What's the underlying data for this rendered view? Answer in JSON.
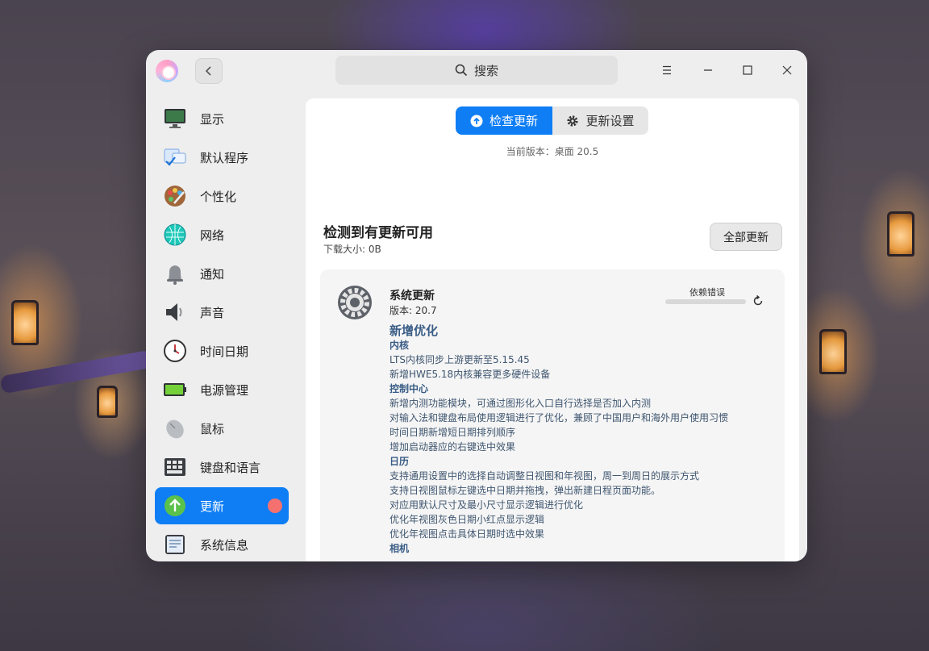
{
  "header": {
    "search_label": "搜索"
  },
  "sidebar": {
    "items": [
      {
        "label": "显示",
        "icon": "monitor-icon"
      },
      {
        "label": "默认程序",
        "icon": "default-apps-icon"
      },
      {
        "label": "个性化",
        "icon": "palette-icon"
      },
      {
        "label": "网络",
        "icon": "network-icon"
      },
      {
        "label": "通知",
        "icon": "bell-icon"
      },
      {
        "label": "声音",
        "icon": "speaker-icon"
      },
      {
        "label": "时间日期",
        "icon": "clock-icon"
      },
      {
        "label": "电源管理",
        "icon": "battery-icon"
      },
      {
        "label": "鼠标",
        "icon": "mouse-icon"
      },
      {
        "label": "键盘和语言",
        "icon": "keyboard-icon"
      },
      {
        "label": "更新",
        "icon": "update-arrow-icon",
        "active": true
      },
      {
        "label": "系统信息",
        "icon": "system-info-icon"
      }
    ]
  },
  "tabs": {
    "check": "检查更新",
    "settings": "更新设置"
  },
  "current_version": "当前版本：桌面 20.5",
  "updates": {
    "title": "检测到有更新可用",
    "download_size": "下载大小: 0B",
    "update_all": "全部更新"
  },
  "card": {
    "name": "系统更新",
    "version": "版本: 20.7",
    "status": "依赖错误",
    "notes_title": "新增优化",
    "notes": [
      {
        "text": "内核",
        "heading": true
      },
      {
        "text": "LTS内核同步上游更新至5.15.45"
      },
      {
        "text": "新增HWE5.18内核兼容更多硬件设备"
      },
      {
        "text": "控制中心",
        "heading": true
      },
      {
        "text": "新增内测功能模块，可通过图形化入口自行选择是否加入内测"
      },
      {
        "text": "对输入法和键盘布局使用逻辑进行了优化，兼顾了中国用户和海外用户使用习惯"
      },
      {
        "text": "时间日期新增短日期排列顺序"
      },
      {
        "text": "增加启动器应的右键选中效果"
      },
      {
        "text": "日历",
        "heading": true
      },
      {
        "text": "支持通用设置中的选择自动调整日视图和年视图，周一到周日的展示方式"
      },
      {
        "text": "支持日视图鼠标左键选中日期并拖拽，弹出新建日程页面功能。"
      },
      {
        "text": "对应用默认尺寸及最小尺寸显示逻辑进行优化"
      },
      {
        "text": "优化年视图灰色日期小红点显示逻辑"
      },
      {
        "text": "优化年视图点击具体日期时选中效果"
      },
      {
        "text": "相机",
        "heading": true
      }
    ]
  },
  "colors": {
    "accent": "#0f7ef5",
    "badge": "#f4716f",
    "note_text": "#3f5670"
  }
}
